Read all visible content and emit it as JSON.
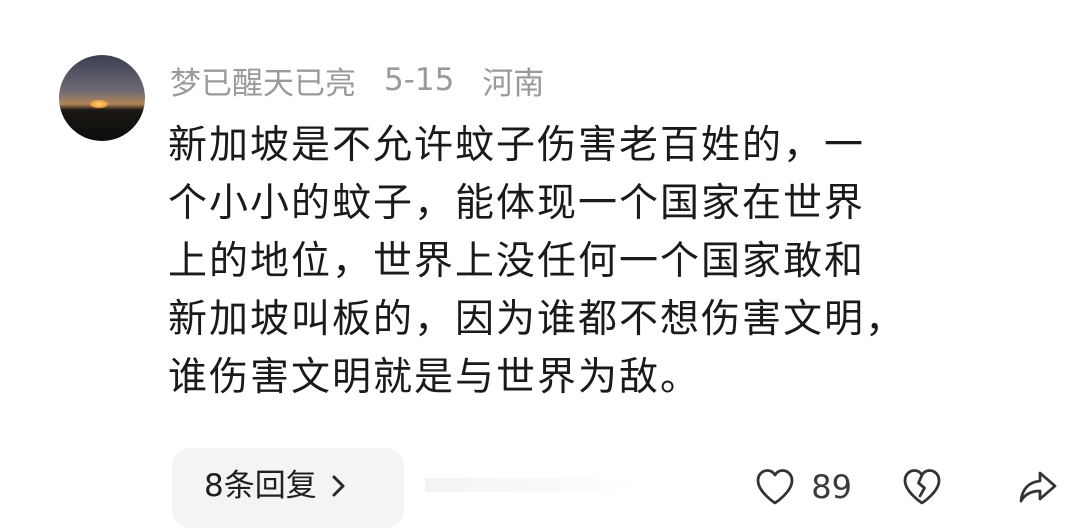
{
  "comment": {
    "username": "梦已醒天已亮",
    "date": "5-15",
    "location": "河南",
    "text_lines": [
      "新加坡是不允许蚊子伤害老百姓的，一",
      "个小小的蚊子，能体现一个国家在世界",
      "上的地位，世界上没任何一个国家敢和",
      "新加坡叫板的，因为谁都不想伤害文明，",
      "谁伤害文明就是与世界为敌。"
    ],
    "replies_label": "8条回复",
    "like_count": "89"
  },
  "icons": {
    "chevron": "chevron-right-icon",
    "like": "heart-outline-icon",
    "dislike": "broken-heart-icon",
    "share": "share-arrow-icon"
  },
  "colors": {
    "meta_text": "#9a9a9a",
    "body_text": "#1a1a1a",
    "reply_bg": "#f4f4f4"
  }
}
